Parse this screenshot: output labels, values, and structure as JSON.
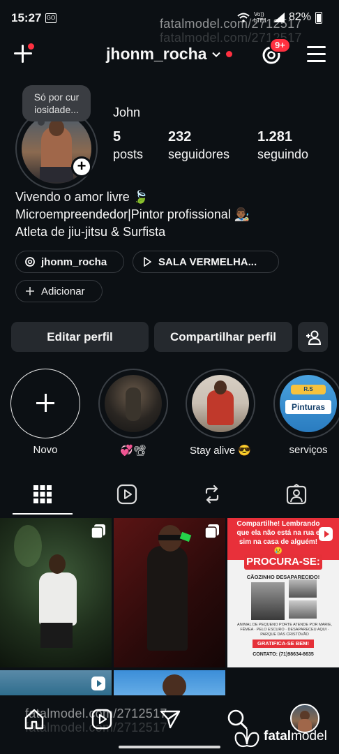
{
  "status_bar": {
    "time": "15:27",
    "app_icon": "GO",
    "net": "Vo)) LTE1",
    "battery": "82%"
  },
  "watermark": "fatalmodel.com/2712517",
  "header": {
    "username": "jhonm_rocha",
    "notif_badge": "9+"
  },
  "profile": {
    "note": "Só por cur iosidade...",
    "display_name": "John",
    "stats": [
      {
        "value": "5",
        "label": "posts"
      },
      {
        "value": "232",
        "label": "seguidores"
      },
      {
        "value": "1.281",
        "label": "seguindo"
      }
    ],
    "bio": [
      "Vivendo o amor livre 🍃",
      "Microempreendedor|Pintor profissional 👨🏾‍🎨",
      "Atleta de jiu-jitsu & Surfista"
    ],
    "threads_chip": "jhonm_rocha",
    "link_chip": "SALA VERMELHA...",
    "add_chip": "Adicionar"
  },
  "actions": {
    "edit": "Editar perfil",
    "share": "Compartilhar perfil"
  },
  "highlights": [
    {
      "label": "Novo"
    },
    {
      "label": "💞📽"
    },
    {
      "label": "Stay alive 😎"
    },
    {
      "label": "serviços"
    }
  ],
  "highlight_art": {
    "pinturas_top": "R.S",
    "pinturas": "Pinturas"
  },
  "poster": {
    "top_text": "Compartilhe! Lembrando que ela não está na rua e sim na casa de alguém! 😢",
    "procura": "PROCURA-SE:",
    "sub": "CÃOZINHO DESAPARECIDO!",
    "desc": "ANIMAL DE PEQUENO PORTE ATENDE POR MARIE, FÊMEA · PELO ESCURO · DESAPARECEU AQUI · PARQUE DAS CRISTÓVÃO",
    "reward": "GRATIFICA-SE BEM!",
    "contact": "CONTATO: (71)98634-8635"
  },
  "brand": {
    "bold": "fatal",
    "light": "model"
  }
}
